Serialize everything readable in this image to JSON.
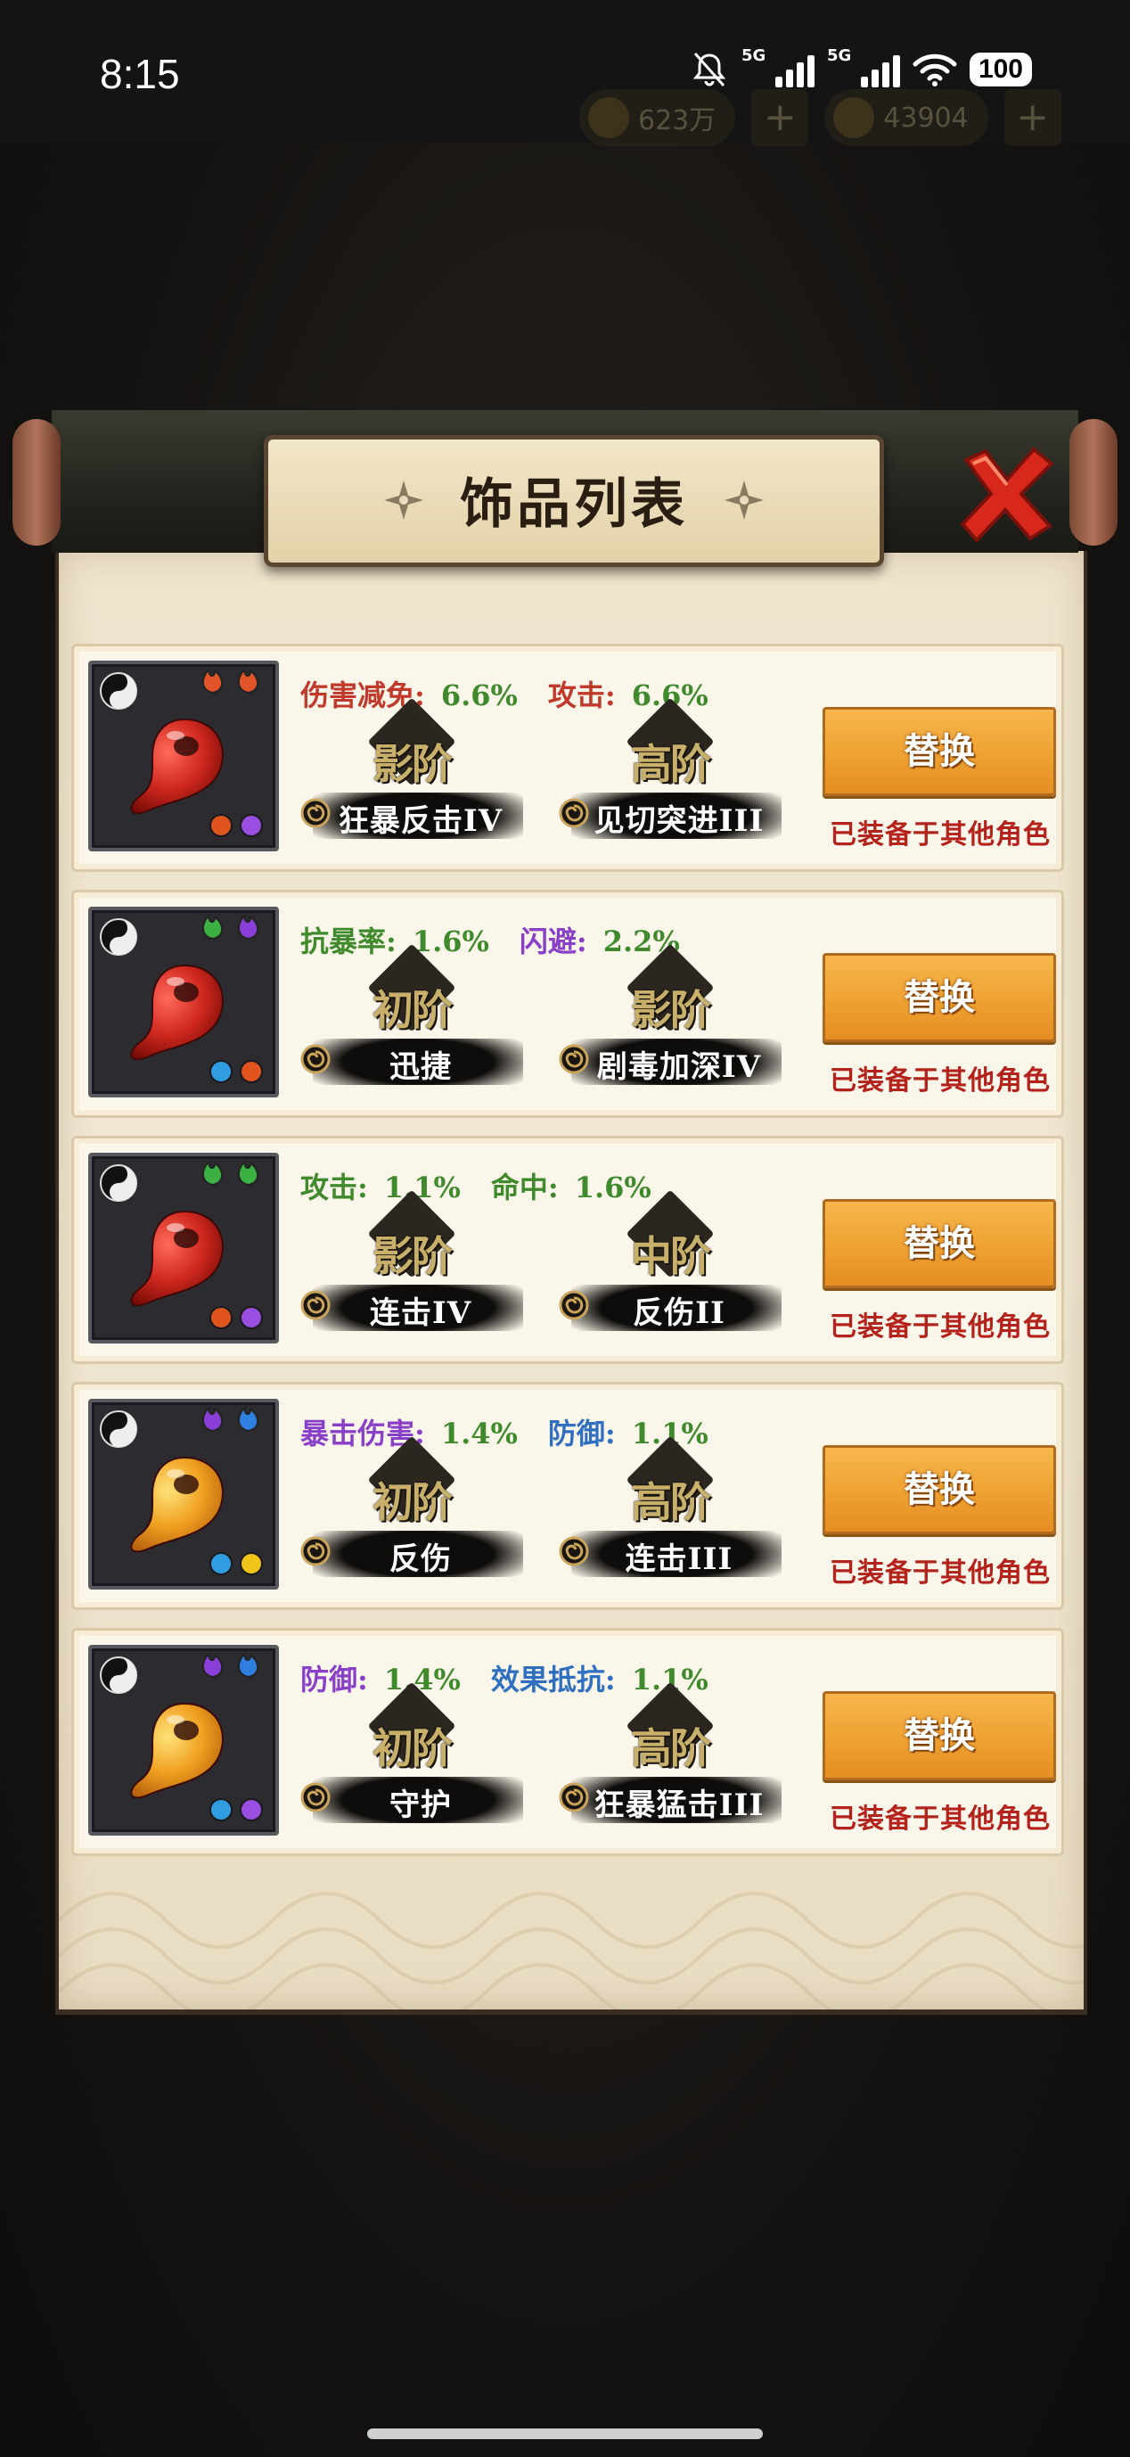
{
  "status_bar": {
    "time": "8:15",
    "network_1": "5G",
    "network_2": "5G",
    "battery": "100"
  },
  "hud": {
    "coins": "623万",
    "gems": "43904",
    "plus": "+"
  },
  "dialog": {
    "title": "饰品列表"
  },
  "button_label": "替换",
  "equip_note": "已装备于其他角色",
  "colors": {
    "red": "#c0392b",
    "green": "#3f8a2c",
    "purple": "#8a3fc8",
    "blue": "#2f6fc0",
    "button": "#f2a93b"
  },
  "items": [
    {
      "jewel": "red",
      "flames": [
        "#e2542a",
        "#e2542a"
      ],
      "dots": [
        "#e2541e",
        "#9a4fe0"
      ],
      "stat1": {
        "label": "伤害减免:",
        "value": "6.6%",
        "label_color": "#c0392b",
        "value_color": "#3f8a2c"
      },
      "stat2": {
        "label": "攻击:",
        "value": "6.6%",
        "label_color": "#c0392b",
        "value_color": "#3f8a2c"
      },
      "skills": [
        {
          "tier": "影阶",
          "name": "狂暴反击IV"
        },
        {
          "tier": "高阶",
          "name": "见切突进III"
        }
      ]
    },
    {
      "jewel": "red",
      "flames": [
        "#3cb043",
        "#8a3fd8"
      ],
      "dots": [
        "#2f9de0",
        "#e2541e"
      ],
      "stat1": {
        "label": "抗暴率:",
        "value": "1.6%",
        "label_color": "#3f8a2c",
        "value_color": "#3f8a2c"
      },
      "stat2": {
        "label": "闪避:",
        "value": "2.2%",
        "label_color": "#8a3fc8",
        "value_color": "#3f8a2c"
      },
      "skills": [
        {
          "tier": "初阶",
          "name": "迅捷"
        },
        {
          "tier": "影阶",
          "name": "剧毒加深IV"
        }
      ]
    },
    {
      "jewel": "red",
      "flames": [
        "#3cb043",
        "#3cb043"
      ],
      "dots": [
        "#e2541e",
        "#9a4fe0"
      ],
      "stat1": {
        "label": "攻击:",
        "value": "1.1%",
        "label_color": "#3f8a2c",
        "value_color": "#3f8a2c"
      },
      "stat2": {
        "label": "命中:",
        "value": "1.6%",
        "label_color": "#3f8a2c",
        "value_color": "#3f8a2c"
      },
      "skills": [
        {
          "tier": "影阶",
          "name": "连击IV"
        },
        {
          "tier": "中阶",
          "name": "反伤II"
        }
      ]
    },
    {
      "jewel": "gold",
      "flames": [
        "#8a3fd8",
        "#2f7fe0"
      ],
      "dots": [
        "#2f9de0",
        "#f0c419"
      ],
      "stat1": {
        "label": "暴击伤害:",
        "value": "1.4%",
        "label_color": "#8a3fc8",
        "value_color": "#3f8a2c"
      },
      "stat2": {
        "label": "防御:",
        "value": "1.1%",
        "label_color": "#2f6fc0",
        "value_color": "#3f8a2c"
      },
      "skills": [
        {
          "tier": "初阶",
          "name": "反伤"
        },
        {
          "tier": "高阶",
          "name": "连击III"
        }
      ]
    },
    {
      "jewel": "gold",
      "flames": [
        "#8a3fd8",
        "#2f7fe0"
      ],
      "dots": [
        "#2f9de0",
        "#9a4fe0"
      ],
      "stat1": {
        "label": "防御:",
        "value": "1.4%",
        "label_color": "#8a3fc8",
        "value_color": "#3f8a2c"
      },
      "stat2": {
        "label": "效果抵抗:",
        "value": "1.1%",
        "label_color": "#2f6fc0",
        "value_color": "#3f8a2c"
      },
      "skills": [
        {
          "tier": "初阶",
          "name": "守护"
        },
        {
          "tier": "高阶",
          "name": "狂暴猛击III"
        }
      ]
    }
  ]
}
